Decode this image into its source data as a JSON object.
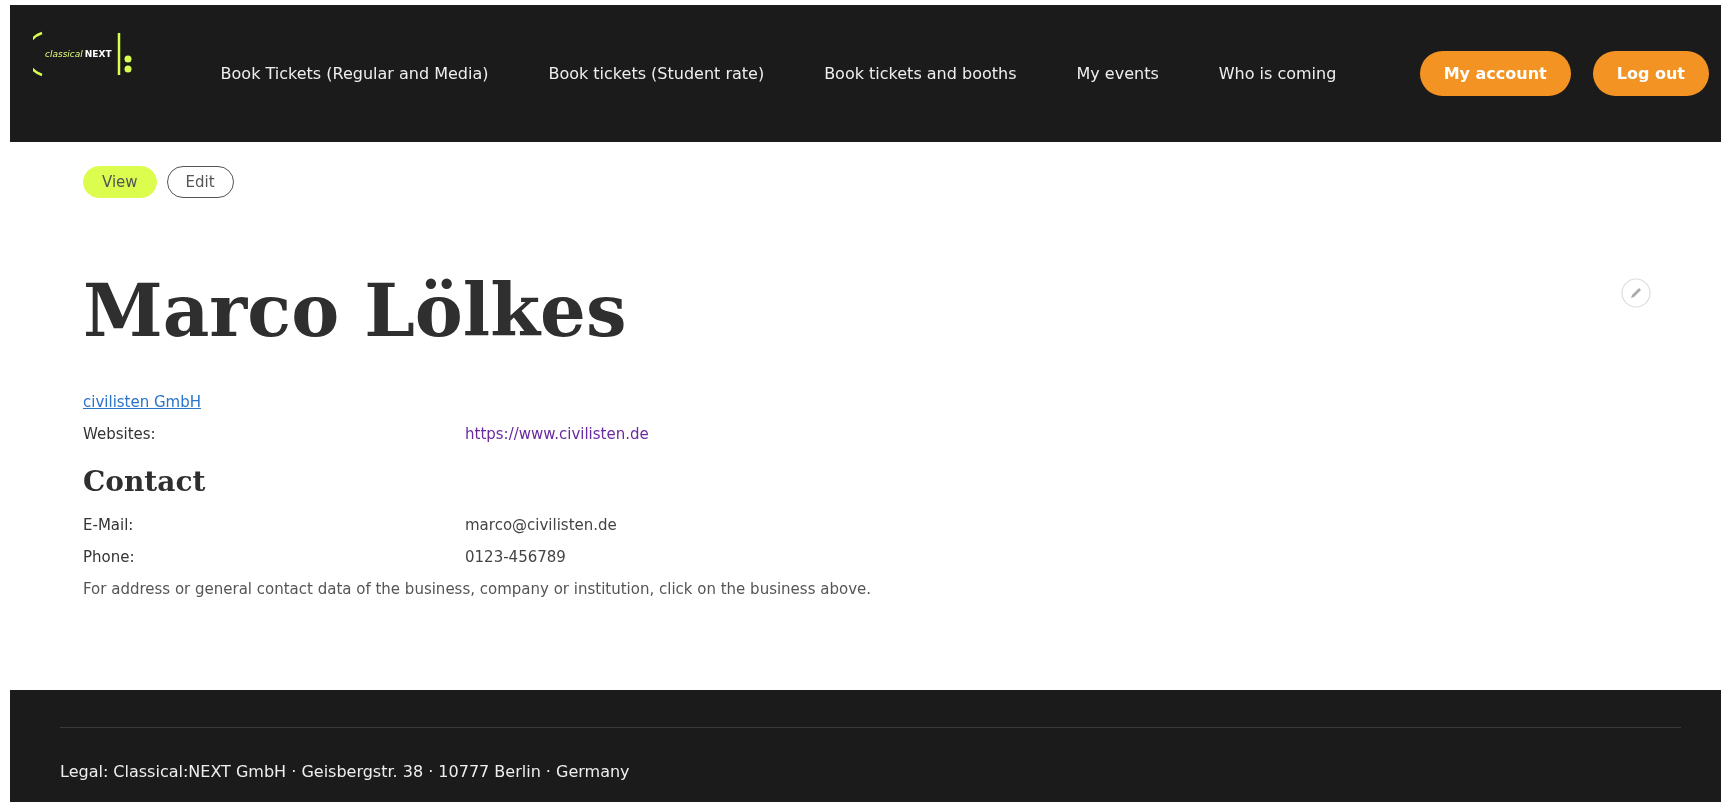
{
  "logo": {
    "text_1": "classical",
    "text_2": "NEXT"
  },
  "nav": [
    "Book Tickets (Regular and Media)",
    "Book tickets (Student rate)",
    "Book tickets and booths",
    "My events",
    "Who is coming"
  ],
  "account_buttons": [
    "My account",
    "Log out"
  ],
  "tabs": [
    {
      "label": "View",
      "selected": true
    },
    {
      "label": "Edit",
      "selected": false
    }
  ],
  "profile": {
    "name": "Marco Lölkes",
    "company": "civilisten GmbH",
    "fields": [
      {
        "label": "Websites:",
        "value": "https://www.civilisten.de"
      }
    ]
  },
  "contact": {
    "heading": "Contact",
    "fields": [
      {
        "label": "E-Mail:",
        "value": "marco@civilisten.de"
      },
      {
        "label": "Phone:",
        "value": "0123-456789"
      }
    ],
    "note": "For address or general contact data of the business, company or institution, click on the business above."
  },
  "footer": {
    "legal": "Legal: Classical:NEXT GmbH · Geisbergstr. 38 · 10777 Berlin · Germany"
  }
}
